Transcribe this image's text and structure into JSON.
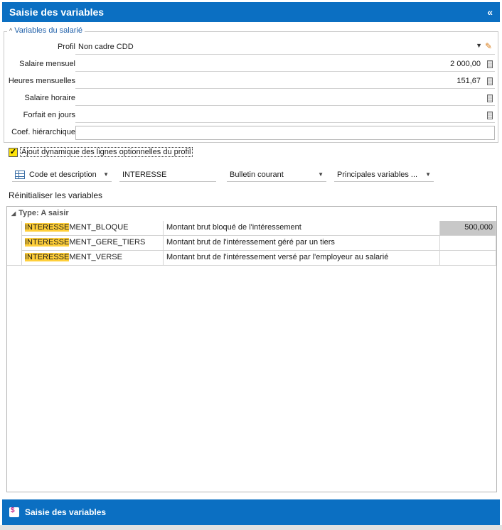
{
  "header": {
    "title": "Saisie des variables",
    "collapse_glyph": "«"
  },
  "group": {
    "title": "Variables du salarié",
    "fields": [
      {
        "label": "Profil",
        "value": "Non cadre CDD",
        "type": "dropdown"
      },
      {
        "label": "Salaire mensuel",
        "value": "2 000,00",
        "type": "calc"
      },
      {
        "label": "Heures mensuelles",
        "value": "151,67",
        "type": "calc"
      },
      {
        "label": "Salaire horaire",
        "value": "",
        "type": "calc"
      },
      {
        "label": "Forfait en jours",
        "value": "",
        "type": "calc"
      },
      {
        "label": "Coef. hiérarchique",
        "value": "",
        "type": "text"
      }
    ]
  },
  "checkbox": {
    "label": "Ajout dynamique des lignes optionnelles du profil",
    "checked": true
  },
  "toolbar": {
    "search_mode": "Code et description",
    "filter_text": "INTERESSE",
    "bulletin": "Bulletin courant",
    "variables": "Principales variables ..."
  },
  "reset_link": "Réinitialiser les variables",
  "grid": {
    "group_label": "Type: A saisir",
    "rows": [
      {
        "code_hl": "INTERESSE",
        "code_rest": "MENT_BLOQUE",
        "description": "Montant brut bloqué de l'intéressement",
        "value": "500,000"
      },
      {
        "code_hl": "INTERESSE",
        "code_rest": "MENT_GERE_TIERS",
        "description": "Montant brut de l'intéressement géré par un tiers",
        "value": ""
      },
      {
        "code_hl": "INTERESSE",
        "code_rest": "MENT_VERSE",
        "description": "Montant brut de l'intéressement versé par l'employeur au salarié",
        "value": ""
      }
    ]
  },
  "footer": {
    "title": "Saisie des variables"
  },
  "colors": {
    "header_blue": "#0b6fc2",
    "highlight": "#ffcf3a",
    "checkbox_yellow": "#ffe40a"
  }
}
